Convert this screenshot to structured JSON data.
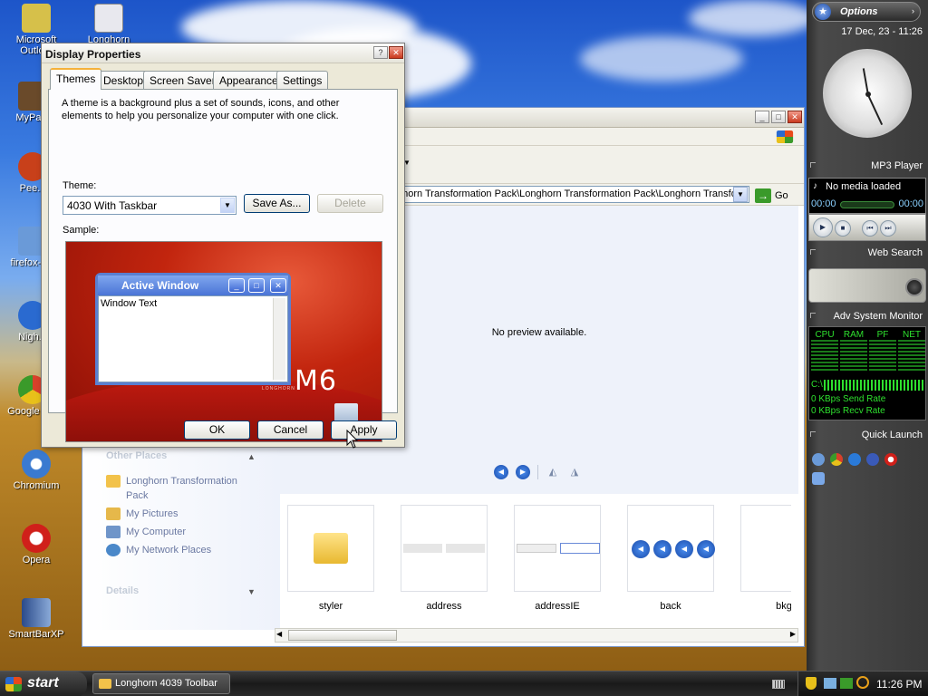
{
  "desktop": {
    "icons": [
      {
        "label": "Microsoft Outlo..."
      },
      {
        "label": "Longhorn"
      },
      {
        "label": "MyPa..."
      },
      {
        "label": "Pee..."
      },
      {
        "label": "firefox-4..."
      },
      {
        "label": "Nigh..."
      },
      {
        "label": "Google C..."
      },
      {
        "label": "Chromium"
      },
      {
        "label": "Opera"
      },
      {
        "label": "SmartBarXP"
      }
    ]
  },
  "explorer": {
    "address": "ghorn Transformation Pack\\Longhorn Transformation Pack\\Longhorn Transfo",
    "go_label": "Go",
    "preview_text": "No preview available.",
    "other_places": {
      "title": "Other Places",
      "items": [
        {
          "label": "Longhorn Transformation Pack",
          "color": "#f2c24a"
        },
        {
          "label": "My Pictures",
          "color": "#e6b84a"
        },
        {
          "label": "My Computer",
          "color": "#6f95c9"
        },
        {
          "label": "My Network Places",
          "color": "#4a88c9"
        }
      ]
    },
    "details_title": "Details",
    "files": [
      {
        "label": "styler"
      },
      {
        "label": "address"
      },
      {
        "label": "addressIE"
      },
      {
        "label": "back"
      },
      {
        "label": "bkg"
      }
    ]
  },
  "dialog": {
    "title": "Display Properties",
    "tabs": [
      "Themes",
      "Desktop",
      "Screen Saver",
      "Appearance",
      "Settings"
    ],
    "active_tab": "Themes",
    "description": "A theme is a background plus a set of sounds, icons, and other elements to help you personalize your computer with one click.",
    "theme_label": "Theme:",
    "theme_value": "4030 With Taskbar",
    "save_as": "Save As...",
    "delete": "Delete",
    "sample_label": "Sample:",
    "sample": {
      "window_title": "Active Window",
      "window_text": "Window Text",
      "brand": "M6",
      "brand_small": "LONGHORN"
    },
    "ok": "OK",
    "cancel": "Cancel",
    "apply": "Apply"
  },
  "sidebar": {
    "options": "Options",
    "datetime": "17 Dec, 23 - 11:26",
    "mp3": {
      "title": "MP3 Player",
      "status": "No media loaded",
      "time_left": "00:00",
      "time_right": "00:00"
    },
    "web_search": "Web Search",
    "monitor": {
      "title": "Adv System Monitor",
      "cols": [
        "CPU",
        "RAM",
        "PF",
        "NET"
      ],
      "drive": "C:\\",
      "send": "0 KBps Send Rate",
      "recv": "0 KBps Recv Rate"
    },
    "quick_launch": "Quick Launch"
  },
  "taskbar": {
    "start": "start",
    "task": "Longhorn 4039 Toolbar",
    "time": "11:26 PM"
  }
}
